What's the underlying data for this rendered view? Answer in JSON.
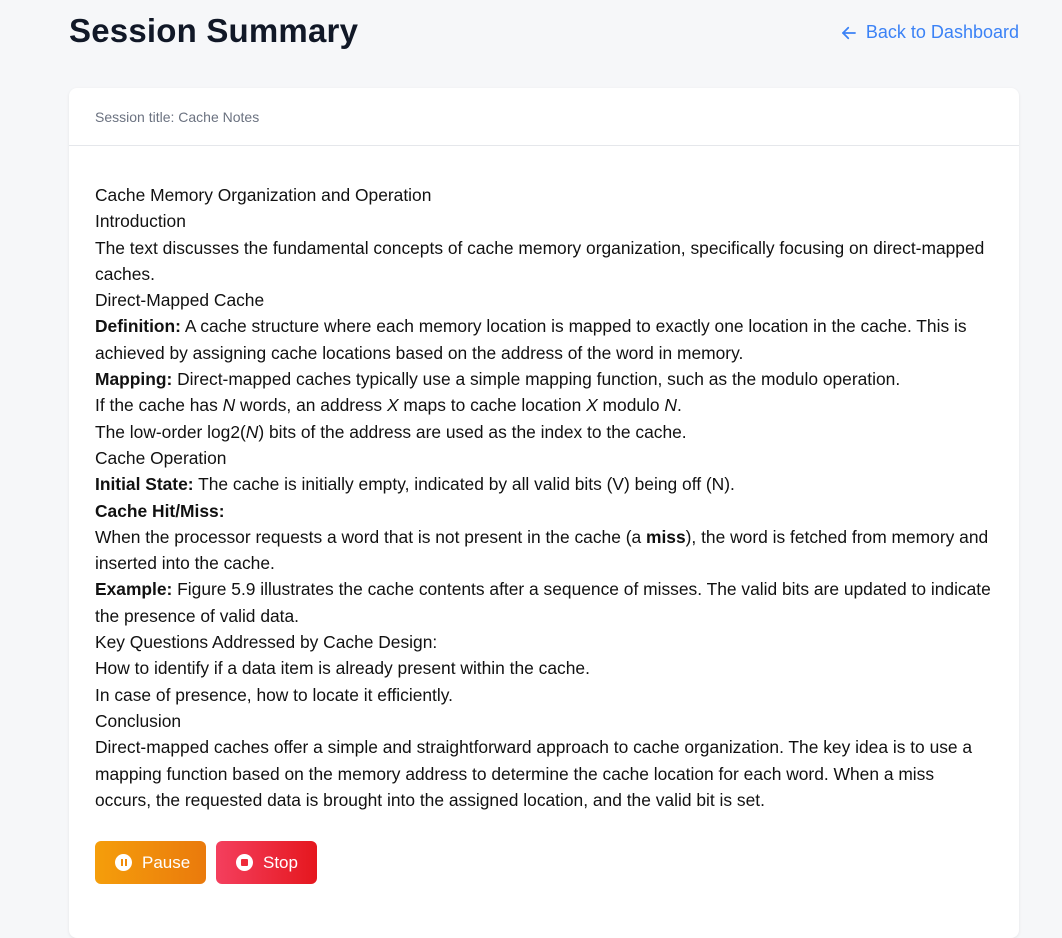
{
  "header": {
    "title": "Session Summary",
    "back_label": "Back to Dashboard"
  },
  "session": {
    "title_label": "Session title: Cache Notes"
  },
  "summary": {
    "h_main": "Cache Memory Organization and Operation",
    "h_intro": "Introduction",
    "p_intro": "The text discusses the fundamental concepts of cache memory organization, specifically focusing on direct-mapped caches.",
    "h_direct": "Direct-Mapped Cache",
    "def_label": "Definition:",
    "def_text": " A cache structure where each memory location is mapped to exactly one location in the cache. This is achieved by assigning cache locations based on the address of the word in memory.",
    "map_label": "Mapping:",
    "map_text": " Direct-mapped caches typically use a simple mapping function, such as the modulo operation.",
    "line_n_1": "If the cache has ",
    "var_n": "N",
    "line_n_2": " words, an address ",
    "var_x": "X",
    "line_n_3": " maps to cache location ",
    "line_n_4": " modulo ",
    "line_n_5": ".",
    "line_log_1": "The low-order log2(",
    "line_log_2": ") bits of the address are used as the index to the cache.",
    "h_operation": "Cache Operation",
    "init_label": "Initial State:",
    "init_text": " The cache is initially empty, indicated by all valid bits (V) being off (N).",
    "hitmiss_label": "Cache Hit/Miss:",
    "hitmiss_1": "When the processor requests a word that is not present in the cache (a ",
    "miss_word": "miss",
    "hitmiss_2": "), the word is fetched from memory and inserted into the cache.",
    "example_label": "Example:",
    "example_text": " Figure 5.9 illustrates the cache contents after a sequence of misses. The valid bits are updated to indicate the presence of valid data.",
    "h_questions": "Key Questions Addressed by Cache Design:",
    "q1": "How to identify if a data item is already present within the cache.",
    "q2": "In case of presence, how to locate it efficiently.",
    "h_conclusion": "Conclusion",
    "p_conclusion": "Direct-mapped caches offer a simple and straightforward approach to cache organization. The key idea is to use a mapping function based on the memory address to determine the cache location for each word. When a miss occurs, the requested data is brought into the assigned location, and the valid bit is set."
  },
  "controls": {
    "pause_label": "Pause",
    "stop_label": "Stop",
    "pause_icon": "pause-circle-icon",
    "stop_icon": "stop-circle-icon"
  },
  "colors": {
    "accent_link": "#3b82f6",
    "pause_start": "#f59e0b",
    "pause_end": "#ea7a0c",
    "stop_start": "#f43f5e",
    "stop_end": "#e5171e"
  }
}
